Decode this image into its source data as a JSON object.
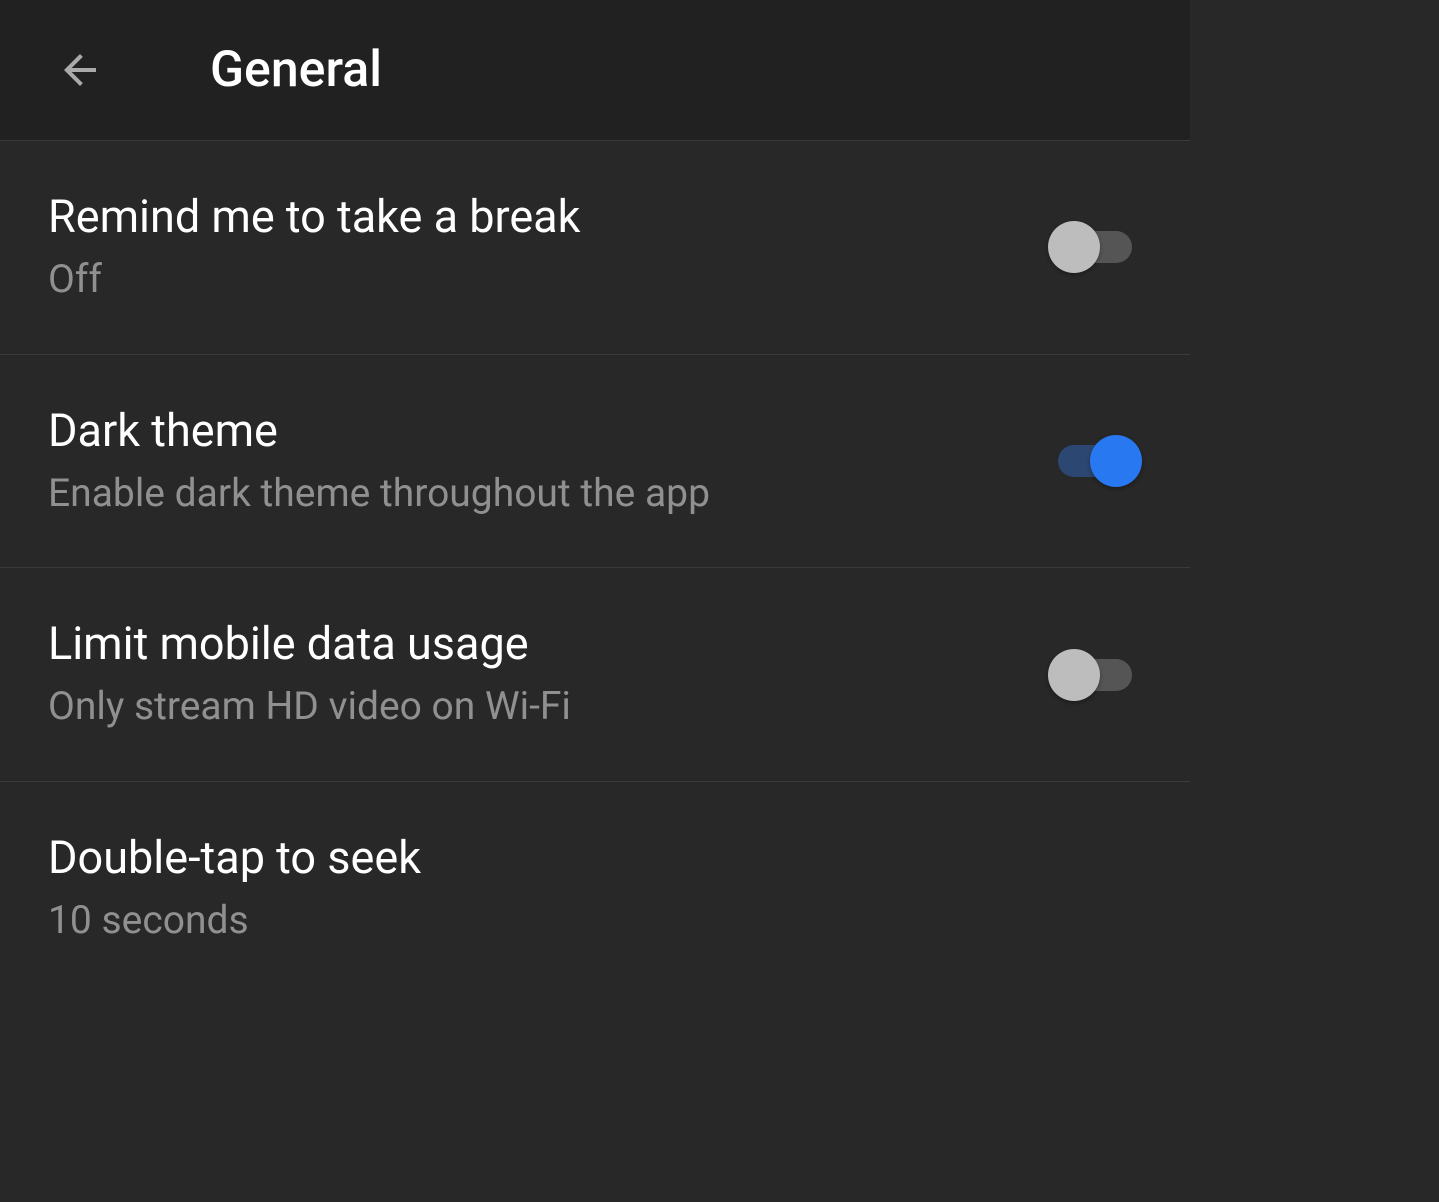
{
  "header": {
    "title": "General"
  },
  "settings": {
    "break_reminder": {
      "title": "Remind me to take a break",
      "subtitle": "Off",
      "enabled": false
    },
    "dark_theme": {
      "title": "Dark theme",
      "subtitle": "Enable dark theme throughout the app",
      "enabled": true
    },
    "limit_data": {
      "title": "Limit mobile data usage",
      "subtitle": "Only stream HD video on Wi-Fi",
      "enabled": false
    },
    "double_tap_seek": {
      "title": "Double-tap to seek",
      "subtitle": "10 seconds"
    }
  },
  "colors": {
    "background": "#282828",
    "header_bg": "#212121",
    "text_primary": "#ffffff",
    "text_secondary": "#909090",
    "toggle_on": "#2879f1",
    "toggle_on_track": "#2c4771",
    "toggle_off": "#bdbdbd",
    "toggle_off_track": "#555555"
  }
}
